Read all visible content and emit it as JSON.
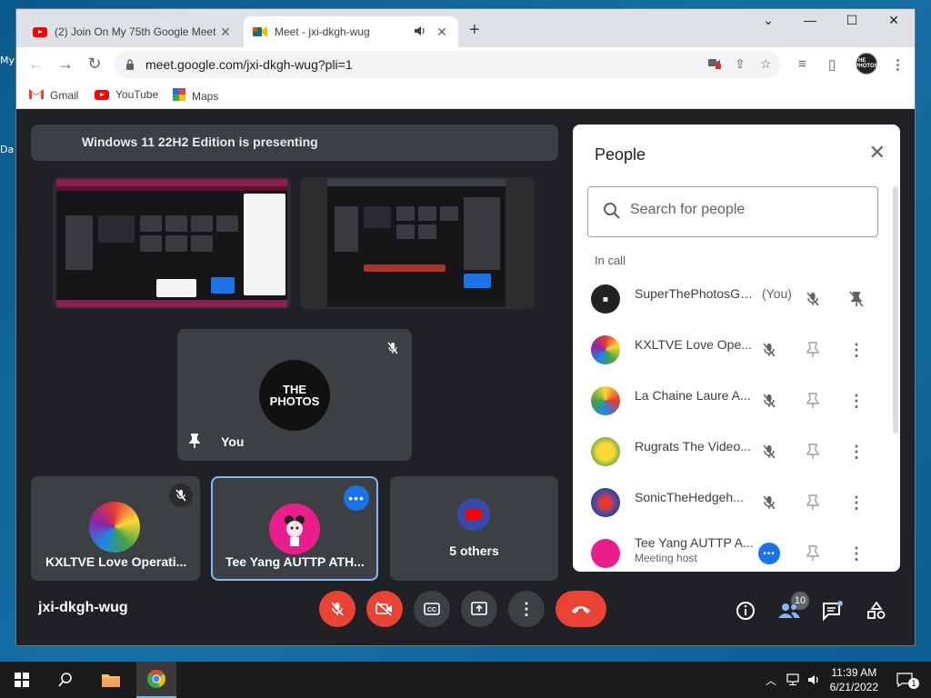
{
  "desktop": {
    "labels": [
      "My",
      "Da"
    ]
  },
  "browser": {
    "tabs": [
      {
        "title": "(2) Join On My 75th Google Meet",
        "close": "✕"
      },
      {
        "title": "Meet - jxi-dkgh-wug",
        "close": "✕"
      }
    ],
    "new_tab": "+",
    "url": "meet.google.com/jxi-dkgh-wug?pli=1",
    "bookmarks": [
      "Gmail",
      "YouTube",
      "Maps"
    ],
    "profile_initials": "THE PHOTOS"
  },
  "meet": {
    "presenting_banner": "Windows 11 22H2 Edition is presenting",
    "you_tile": {
      "name": "You",
      "avatar_text": "THE PHOTOS"
    },
    "tiles": [
      {
        "name": "KXLTVE Love Operati..."
      },
      {
        "name": "Tee Yang AUTTP ATH..."
      },
      {
        "name": "5 others"
      }
    ],
    "meeting_code": "jxi-dkgh-wug",
    "participant_count": "10"
  },
  "people_panel": {
    "title": "People",
    "search_placeholder": "Search for people",
    "section_label": "In call",
    "participants": [
      {
        "name": "SuperThePhotosGa...",
        "suffix": "(You)",
        "sub": "",
        "color": "#222222"
      },
      {
        "name": "KXLTVE Love Ope...",
        "suffix": "",
        "sub": "",
        "color": "#e53935"
      },
      {
        "name": "La Chaine Laure A...",
        "suffix": "",
        "sub": "",
        "color": "#fdd835"
      },
      {
        "name": "Rugrats The Video...",
        "suffix": "",
        "sub": "",
        "color": "#7cb342"
      },
      {
        "name": "SonicTheHedgeh...",
        "suffix": "",
        "sub": "",
        "color": "#3949ab"
      },
      {
        "name": "Tee Yang AUTTP A...",
        "suffix": "",
        "sub": "Meeting host",
        "color": "#e91e63"
      }
    ]
  },
  "taskbar": {
    "time": "11:39 AM",
    "date": "6/21/2022",
    "notifications": "1"
  },
  "colors": {
    "meet_bg": "#202124",
    "tile_bg": "#3c4043",
    "red": "#ea4335",
    "accent_blue": "#1a73e8"
  }
}
